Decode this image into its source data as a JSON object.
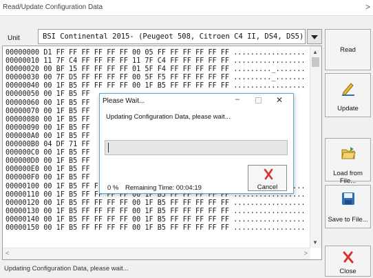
{
  "window": {
    "title": "Read/Update Configuration Data",
    "close_glyph": ">"
  },
  "unit": {
    "label": "Unit",
    "selected": "BSI Continental 2015- (Peugeot 508, Citroen C4 II, DS4, DS5)"
  },
  "hex_lines": [
    "00000000 D1 FF FF FF FF FF FF 00 05 FF FF FF FF FF FF .................",
    "00000010 11 7F C4 FF FF FF FF 11 7F C4 FF FF FF FF FF .................",
    "00000020 00 BF 15 FF FF FF FF 01 5F F4 FF FF FF FF FF ........._.......",
    "00000030 00 7F D5 FF FF FF FF 00 5F F5 FF FF FF FF FF ........._.......",
    "00000040 00 1F B5 FF FF FF FF 00 1F B5 FF FF FF FF FF .................",
    "00000050 00 1F B5 FF",
    "00000060 00 1F B5 FF",
    "00000070 00 1F B5 FF",
    "00000080 00 1F B5 FF",
    "00000090 00 1F B5 FF",
    "000000A0 00 1F B5 FF",
    "000000B0 04 DF 71 FF",
    "000000C0 00 1F B5 FF",
    "000000D0 00 1F B5 FF",
    "000000E0 00 1F B5 FF",
    "000000F0 00 1F B5 FF",
    "00000100 00 1F B5 FF FF FF FF 00 1F B5 FF FF FF FF FF .................",
    "00000110 00 1F B5 FF FF FF FF 00 1F B5 FF FF FF FF FF .................",
    "00000120 00 1F B5 FF FF FF FF 00 1F B5 FF FF FF FF FF .................",
    "00000130 00 1F B5 FF FF FF FF 00 1F B5 FF FF FF FF FF .................",
    "00000140 00 1F B5 FF FF FF FF 00 1F B5 FF FF FF FF FF .................",
    "00000150 00 1F B5 FF FF FF FF 00 1F B5 FF FF FF FF FF ................."
  ],
  "status_text": "Updating Configuration Data, please wait...",
  "buttons": {
    "read": "Read",
    "update": "Update",
    "load": "Load from File...",
    "save": "Save to File...",
    "close": "Close"
  },
  "dialog": {
    "title": "Please Wait...",
    "message": "Updating Configuration Data, please wait...",
    "progress_percent": 0,
    "percent_text": "0 %",
    "remaining_text": "Remaining Time: 00:04:19",
    "cancel_label": "Cancel"
  },
  "colors": {
    "accent_blue": "#5aa7d8",
    "cancel_red": "#d9302b",
    "progress_green": "#06b025",
    "pencil_yellow": "#e8b43a",
    "disk_blue": "#2f6fb5"
  }
}
